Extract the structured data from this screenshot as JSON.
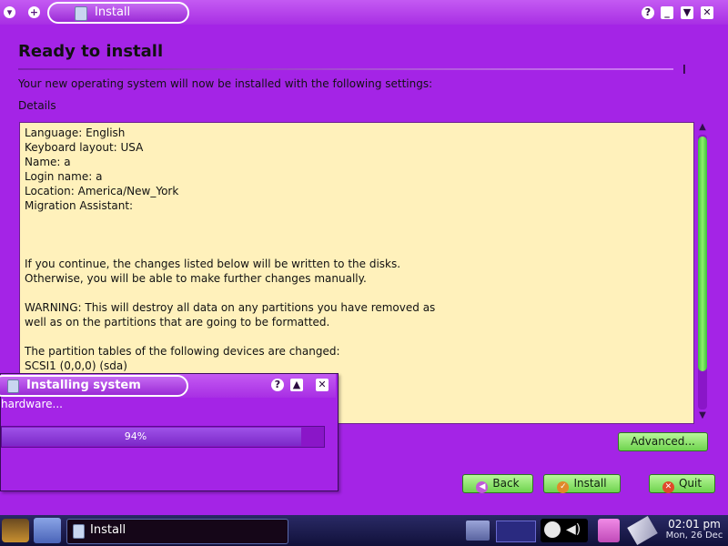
{
  "window": {
    "title": "Install",
    "controls": {
      "help": "?",
      "minimize": "_",
      "shade": "▼",
      "close": "✕"
    },
    "left_controls": {
      "menu": "▾",
      "add": "+"
    }
  },
  "page": {
    "heading": "Ready to install",
    "intro": "Your new operating system will now be installed with the following settings:",
    "details_label": "Details"
  },
  "details_lines": [
    "Language: English",
    "Keyboard layout: USA",
    "Name: a",
    "Login name: a",
    "Location: America/New_York",
    "Migration Assistant:",
    "",
    "",
    "",
    "If you continue, the changes listed below will be written to the disks.",
    "Otherwise, you will be able to make further changes manually.",
    "",
    "WARNING: This will destroy all data on any partitions you have removed as",
    "well as on the partitions that are going to be formatted.",
    "",
    "The partition tables of the following devices are changed:",
    "SCSI1 (0,0,0) (sda)"
  ],
  "buttons": {
    "advanced": "Advanced...",
    "back": "Back",
    "install": "Install",
    "quit": "Quit"
  },
  "progress_dialog": {
    "title": "Installing system",
    "status": "hardware...",
    "progress_percent": 94,
    "progress_label": "94%",
    "controls": {
      "help": "?",
      "shade": "▲",
      "close": "✕"
    }
  },
  "taskbar": {
    "task_label": "Install",
    "clock_time": "02:01 pm",
    "clock_date": "Mon, 26 Dec"
  },
  "colors": {
    "window_bg": "#a424e6",
    "details_bg": "#fff1bb",
    "button_green": "#6ed34e",
    "scroll_thumb": "#3bbf3a",
    "taskbar": "#11113a"
  },
  "icons": [
    "menu-arrow-icon",
    "add-icon",
    "installer-icon",
    "help-icon",
    "minimize-icon",
    "shade-icon",
    "close-icon",
    "back-arrow-icon",
    "check-icon",
    "quit-icon",
    "start-logo-icon",
    "folder-icon",
    "network-icon",
    "volume-icon",
    "battery-icon",
    "clipboard-icon",
    "usb-icon"
  ]
}
